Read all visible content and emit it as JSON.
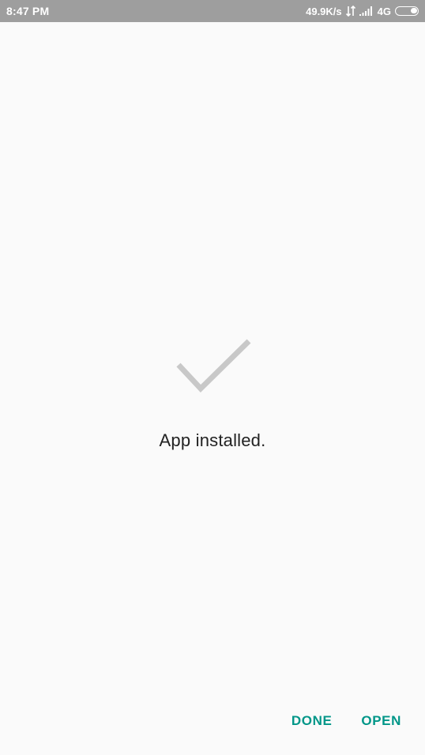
{
  "status_bar": {
    "time": "8:47 PM",
    "net_speed": "49.9K/s",
    "net_type": "4G",
    "icons": [
      "data-transfer-icon",
      "signal-icon",
      "battery-icon"
    ],
    "battery_level": 0.3
  },
  "main": {
    "icon": "checkmark-icon",
    "message": "App installed."
  },
  "actions": {
    "done_label": "DONE",
    "open_label": "OPEN"
  },
  "colors": {
    "accent": "#009688",
    "status_bar": "#9e9e9e",
    "check": "#c8c8c8",
    "background": "#fafafa"
  }
}
